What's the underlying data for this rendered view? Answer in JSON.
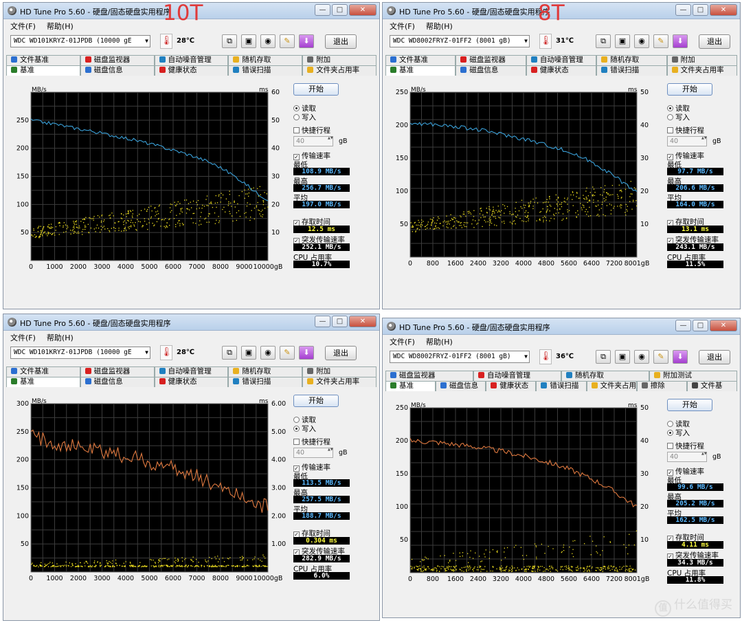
{
  "panels": [
    {
      "title": "HD Tune Pro 5.60 - 硬盘/固态硬盘实用程序",
      "overlay_label": "10T",
      "menu": [
        "文件(F)",
        "帮助(H)"
      ],
      "drive": "WDC    WD101KRYZ-01JPDB (10000 gE",
      "temperature": "28℃",
      "exit_label": "退出",
      "tabs_top": [
        "文件基准",
        "磁盘监视器",
        "自动噪音管理",
        "随机存取",
        "附加"
      ],
      "tabs_bottom": [
        "基准",
        "磁盘信息",
        "健康状态",
        "错误扫描",
        "文件夹占用率"
      ],
      "start_label": "开始",
      "mode_read": "读取",
      "mode_write": "写入",
      "selected_mode": "read",
      "short_stroke": "快捷行程",
      "short_stroke_value": "40",
      "short_stroke_unit": "gB",
      "transfer_rate": "传输速率",
      "min_label": "最低",
      "min_value": "108.9 MB/s",
      "max_label": "最高",
      "max_value": "256.7 MB/s",
      "avg_label": "平均",
      "avg_value": "197.0 MB/s",
      "access_label": "存取时间",
      "access_value": "12.5 ms",
      "burst_label": "突发传输速率",
      "burst_value": "252.1 MB/s",
      "cpu_label": "CPU 占用率",
      "cpu_value": "10.7%"
    },
    {
      "title": "HD Tune Pro 5.60 - 硬盘/固态硬盘实用程序",
      "overlay_label": "8T",
      "menu": [
        "文件(F)",
        "帮助(H)"
      ],
      "drive": "WDC    WD8002FRYZ-01FF2 (8001 gB)",
      "temperature": "31℃",
      "exit_label": "退出",
      "tabs_top": [
        "文件基准",
        "磁盘监视器",
        "自动噪音管理",
        "随机存取",
        "附加"
      ],
      "tabs_bottom": [
        "基准",
        "磁盘信息",
        "健康状态",
        "错误扫描",
        "文件夹占用率"
      ],
      "start_label": "开始",
      "mode_read": "读取",
      "mode_write": "写入",
      "selected_mode": "read",
      "short_stroke": "快捷行程",
      "short_stroke_value": "40",
      "short_stroke_unit": "gB",
      "transfer_rate": "传输速率",
      "min_label": "最低",
      "min_value": "97.7 MB/s",
      "max_label": "最高",
      "max_value": "206.6 MB/s",
      "avg_label": "平均",
      "avg_value": "164.0 MB/s",
      "access_label": "存取时间",
      "access_value": "13.1 ms",
      "burst_label": "突发传输速率",
      "burst_value": "243.1 MB/s",
      "cpu_label": "CPU 占用率",
      "cpu_value": "11.5%"
    },
    {
      "title": "HD Tune Pro 5.60 - 硬盘/固态硬盘实用程序",
      "overlay_label": "",
      "menu": [
        "文件(F)",
        "帮助(H)"
      ],
      "drive": "WDC    WD101KRYZ-01JPDB (10000 gE",
      "temperature": "28℃",
      "exit_label": "退出",
      "tabs_top": [
        "文件基准",
        "磁盘监视器",
        "自动噪音管理",
        "随机存取",
        "附加"
      ],
      "tabs_bottom": [
        "基准",
        "磁盘信息",
        "健康状态",
        "错误扫描",
        "文件夹占用率"
      ],
      "start_label": "开始",
      "mode_read": "读取",
      "mode_write": "写入",
      "selected_mode": "write",
      "short_stroke": "快捷行程",
      "short_stroke_value": "40",
      "short_stroke_unit": "gB",
      "transfer_rate": "传输速率",
      "min_label": "最低",
      "min_value": "113.5 MB/s",
      "max_label": "最高",
      "max_value": "257.5 MB/s",
      "avg_label": "平均",
      "avg_value": "188.7 MB/s",
      "access_label": "存取时间",
      "access_value": "0.304 ms",
      "burst_label": "突发传输速率",
      "burst_value": "282.9 MB/s",
      "cpu_label": "CPU 占用率",
      "cpu_value": "6.0%"
    },
    {
      "title": "HD Tune Pro 5.60 - 硬盘/固态硬盘实用程序",
      "overlay_label": "",
      "menu": [
        "文件(F)",
        "帮助(H)"
      ],
      "drive": "WDC    WD8002FRYZ-01FF2 (8001 gB)",
      "temperature": "36℃",
      "exit_label": "退出",
      "tabs_top": [
        "磁盘监视器",
        "自动噪音管理",
        "随机存取",
        "附加测试"
      ],
      "tabs_bottom": [
        "基准",
        "磁盘信息",
        "健康状态",
        "错误扫描",
        "文件夹占用率",
        "擦除",
        "文件基"
      ],
      "start_label": "开始",
      "mode_read": "读取",
      "mode_write": "写入",
      "selected_mode": "write",
      "short_stroke": "快捷行程",
      "short_stroke_value": "40",
      "short_stroke_unit": "gB",
      "transfer_rate": "传输速率",
      "min_label": "最低",
      "min_value": "99.6 MB/s",
      "max_label": "最高",
      "max_value": "205.2 MB/s",
      "avg_label": "平均",
      "avg_value": "162.5 MB/s",
      "access_label": "存取时间",
      "access_value": "4.11 ms",
      "burst_label": "突发传输速率",
      "burst_value": "34.3 MB/s",
      "cpu_label": "CPU 占用率",
      "cpu_value": "11.8%"
    }
  ],
  "chart_data": [
    {
      "type": "line",
      "y_label": "MB/s",
      "y2_label": "ms",
      "ylim": [
        0,
        300
      ],
      "y2lim": [
        0,
        60
      ],
      "y_ticks": [
        "50",
        "100",
        "150",
        "200",
        "250"
      ],
      "y2_ticks": [
        "10",
        "20",
        "30",
        "40",
        "50",
        "60"
      ],
      "x_ticks": [
        "0",
        "1000",
        "2000",
        "3000",
        "4000",
        "5000",
        "6000",
        "7000",
        "8000",
        "9000",
        "10000gB"
      ],
      "xlim": [
        0,
        10000
      ],
      "line_color": "#3aa0d8",
      "series": [
        {
          "values": [
            250,
            246,
            243,
            238,
            234,
            230,
            225,
            221,
            216,
            211,
            205,
            199,
            193,
            186,
            178,
            168,
            155,
            140,
            122,
            108
          ]
        }
      ],
      "scatter_y_range": [
        5,
        25
      ],
      "scatter_color": "#f0e020"
    },
    {
      "type": "line",
      "y_label": "MB/s",
      "y2_label": "ms",
      "ylim": [
        0,
        250
      ],
      "y2lim": [
        0,
        50
      ],
      "y_ticks": [
        "50",
        "100",
        "150",
        "200",
        "250"
      ],
      "y2_ticks": [
        "10",
        "20",
        "30",
        "40",
        "50"
      ],
      "x_ticks": [
        "0",
        "800",
        "1600",
        "2400",
        "3200",
        "4000",
        "4800",
        "5600",
        "6400",
        "7200",
        "8001gB"
      ],
      "xlim": [
        0,
        8001
      ],
      "line_color": "#3aa0d8",
      "series": [
        {
          "values": [
            203,
            202,
            201,
            199,
            197,
            195,
            192,
            189,
            185,
            181,
            177,
            172,
            167,
            161,
            154,
            146,
            136,
            124,
            111,
            99
          ]
        }
      ],
      "scatter_y_range": [
        5,
        22
      ],
      "scatter_color": "#f0e020"
    },
    {
      "type": "line",
      "y_label": "MB/s",
      "y2_label": "ms",
      "ylim": [
        0,
        300
      ],
      "y2lim": [
        0,
        6
      ],
      "y_ticks": [
        "50",
        "100",
        "150",
        "200",
        "250",
        "300"
      ],
      "y2_ticks": [
        "1.00",
        "2.00",
        "3.00",
        "4.00",
        "5.00",
        "6.00"
      ],
      "x_ticks": [
        "0",
        "1000",
        "2000",
        "3000",
        "4000",
        "5000",
        "6000",
        "7000",
        "8000",
        "9000",
        "10000gB"
      ],
      "xlim": [
        0,
        10000
      ],
      "line_color": "#e07a40",
      "series": [
        {
          "values": [
            240,
            235,
            230,
            225,
            222,
            218,
            214,
            210,
            205,
            199,
            193,
            187,
            180,
            172,
            164,
            155,
            146,
            135,
            124,
            114
          ]
        }
      ],
      "scatter_y_range": [
        0.2,
        0.6
      ],
      "scatter_color": "#f0e020"
    },
    {
      "type": "line",
      "y_label": "MB/s",
      "y2_label": "ms",
      "ylim": [
        0,
        250
      ],
      "y2lim": [
        0,
        50
      ],
      "y_ticks": [
        "50",
        "100",
        "150",
        "200",
        "250"
      ],
      "y2_ticks": [
        "10",
        "20",
        "30",
        "40",
        "50"
      ],
      "x_ticks": [
        "0",
        "800",
        "1600",
        "2400",
        "3200",
        "4000",
        "4800",
        "5600",
        "6400",
        "7200",
        "8001gB"
      ],
      "xlim": [
        0,
        8001
      ],
      "line_color": "#e07a40",
      "series": [
        {
          "values": [
            200,
            199,
            198,
            196,
            194,
            192,
            189,
            186,
            183,
            179,
            175,
            170,
            165,
            159,
            152,
            144,
            135,
            124,
            112,
            100
          ]
        }
      ],
      "scatter_y_range": [
        0.5,
        12
      ],
      "scatter_color": "#f0e020"
    }
  ],
  "watermark": "什么值得买",
  "watermark_icon": "值"
}
